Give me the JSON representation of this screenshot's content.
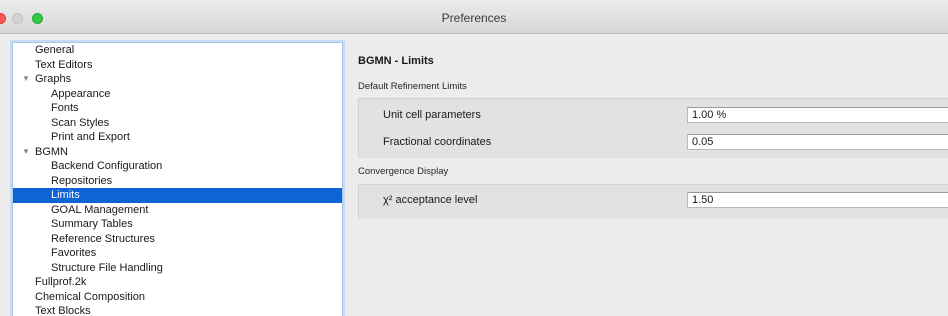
{
  "window": {
    "title": "Preferences"
  },
  "sidebar": {
    "items": [
      {
        "label": "General",
        "selected": false
      },
      {
        "label": "Text Editors",
        "selected": false
      },
      {
        "label": "Graphs",
        "selected": false,
        "expanded": true
      },
      {
        "label": "Appearance",
        "selected": false
      },
      {
        "label": "Fonts",
        "selected": false
      },
      {
        "label": "Scan Styles",
        "selected": false
      },
      {
        "label": "Print and Export",
        "selected": false
      },
      {
        "label": "BGMN",
        "selected": false,
        "expanded": true
      },
      {
        "label": "Backend Configuration",
        "selected": false
      },
      {
        "label": "Repositories",
        "selected": false
      },
      {
        "label": "Limits",
        "selected": true
      },
      {
        "label": "GOAL Management",
        "selected": false
      },
      {
        "label": "Summary Tables",
        "selected": false
      },
      {
        "label": "Reference Structures",
        "selected": false
      },
      {
        "label": "Favorites",
        "selected": false
      },
      {
        "label": "Structure File Handling",
        "selected": false
      },
      {
        "label": "Fullprof.2k",
        "selected": false
      },
      {
        "label": "Chemical Composition",
        "selected": false
      },
      {
        "label": "Text Blocks",
        "selected": false
      }
    ]
  },
  "main": {
    "title": "BGMN - Limits",
    "refinement": {
      "header": "Default Refinement Limits",
      "unit_cell_label": "Unit cell parameters",
      "unit_cell_value": "1.00 %",
      "fractional_label": "Fractional coordinates",
      "fractional_value": "0.05"
    },
    "convergence": {
      "header": "Convergence Display",
      "chi_label": "χ² acceptance level",
      "chi_value": "1.50"
    }
  }
}
